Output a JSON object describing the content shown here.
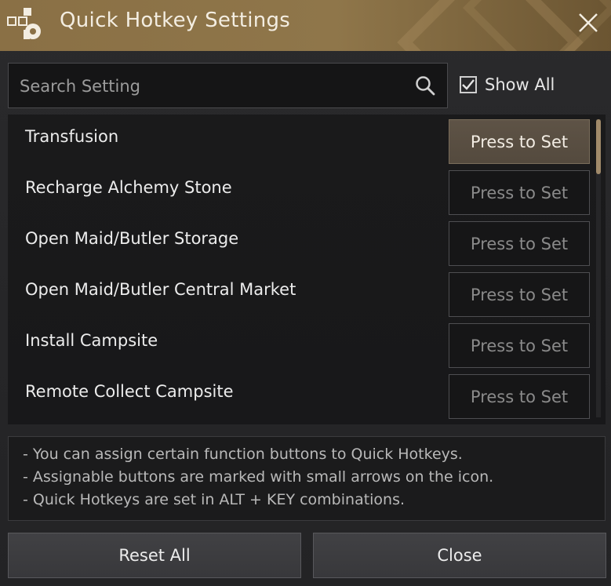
{
  "window": {
    "title": "Quick Hotkey Settings"
  },
  "search": {
    "placeholder": "Search Setting",
    "value": ""
  },
  "show_all": {
    "label": "Show All",
    "checked": true
  },
  "hotkeys": [
    {
      "label": "Transfusion",
      "button": "Press to Set",
      "active": true
    },
    {
      "label": "Recharge Alchemy Stone",
      "button": "Press to Set",
      "active": false
    },
    {
      "label": "Open Maid/Butler Storage",
      "button": "Press to Set",
      "active": false
    },
    {
      "label": "Open Maid/Butler Central Market",
      "button": "Press to Set",
      "active": false
    },
    {
      "label": "Install Campsite",
      "button": "Press to Set",
      "active": false
    },
    {
      "label": "Remote Collect Campsite",
      "button": "Press to Set",
      "active": false
    }
  ],
  "info": {
    "lines": [
      "- You can assign certain function buttons to Quick Hotkeys.",
      "- Assignable buttons are marked with small arrows on the icon.",
      "- Quick Hotkeys are set in ALT + KEY combinations."
    ]
  },
  "footer": {
    "reset_label": "Reset All",
    "close_label": "Close"
  },
  "colors": {
    "title_bar": "#8a7045",
    "active_button": "#5e5346",
    "scroll_thumb": "#a08a6a"
  },
  "icons": {
    "title": "hotkey-gear-icon",
    "close": "close-icon",
    "search": "search-icon",
    "checkbox": "checkmark-icon"
  }
}
